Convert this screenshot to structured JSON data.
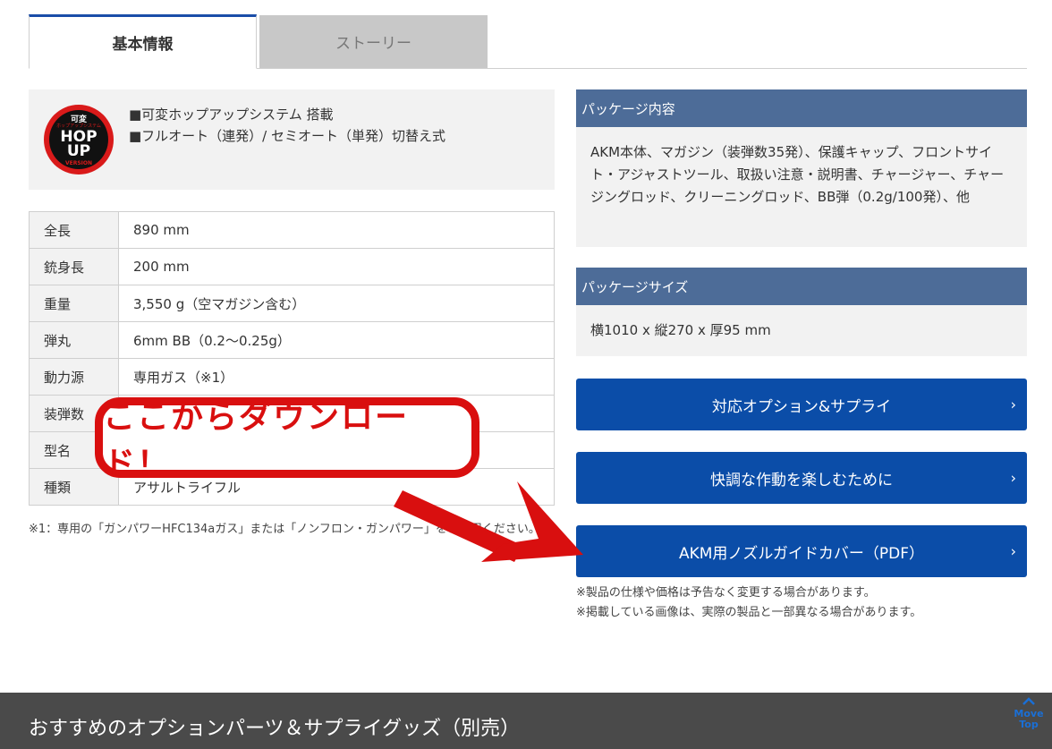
{
  "tabs": {
    "basic": "基本情報",
    "story": "ストーリー"
  },
  "feature": {
    "logo": {
      "top": "可変",
      "main1": "HOP",
      "main2": "UP",
      "sub": "VERSION",
      "arc": "ホップアップシステム"
    },
    "lines": [
      "■可変ホップアップシステム 搭載",
      "■フルオート（連発）/ セミオート（単発）切替え式"
    ]
  },
  "specs": [
    {
      "key": "全長",
      "value": "890 mm"
    },
    {
      "key": "銃身長",
      "value": "200 mm"
    },
    {
      "key": "重量",
      "value": "3,550 g（空マガジン含む）"
    },
    {
      "key": "弾丸",
      "value": "6mm BB（0.2〜0.25g）"
    },
    {
      "key": "動力源",
      "value": "専用ガス（※1）"
    },
    {
      "key": "装弾数",
      "value": ""
    },
    {
      "key": "型名",
      "value": ""
    },
    {
      "key": "種類",
      "value": "アサルトライフル"
    }
  ],
  "note1": "※1：専用の「ガンパワーHFC134aガス」または「ノンフロン・ガンパワー」をご使用ください。",
  "package_contents": {
    "title": "パッケージ内容",
    "body": "AKM本体、マガジン（装弾数35発）、保護キャップ、フロントサイト・アジャストツール、取扱い注意・説明書、チャージャー、チャージングロッド、クリーニングロッド、BB弾（0.2g/100発）、他"
  },
  "package_size": {
    "title": "パッケージサイズ",
    "body": "横1010 x 縦270 x 厚95 mm"
  },
  "buttons": {
    "options": "対応オプション&サプライ",
    "care": "快調な作動を楽しむために",
    "pdf": "AKM用ノズルガイドカバー（PDF）",
    "chevron": "›"
  },
  "disclaimer": [
    "※製品の仕様や価格は予告なく変更する場合があります。",
    "※掲載している画像は、実際の製品と一部異なる場合があります。"
  ],
  "callout": "ここからダウンロード！",
  "footer": {
    "title": "おすすめのオプションパーツ＆サプライグッズ（別売）",
    "move_top_1": "Move",
    "move_top_2": "Top"
  },
  "colors": {
    "header_blue": "#4d6c98",
    "button_blue": "#0b4da8",
    "callout_red": "#d90f0f",
    "footer_gray": "#4a4a4a"
  }
}
